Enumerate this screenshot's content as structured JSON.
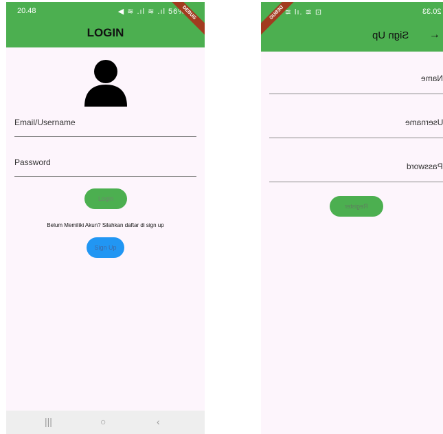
{
  "login_screen": {
    "status_bar": {
      "time": "20.48",
      "icons": "◀ ≋ .ıl ≋ .ıl 56%"
    },
    "debug_badge": "DEBUG",
    "title": "LOGIN",
    "avatar_icon": "person-icon",
    "email_label": "Email/Username",
    "password_label": "Password",
    "login_button": "Login",
    "signup_hint": "Belum Memiliki Akun? Silahkan daftar di sign up",
    "signup_button": "Sign Up",
    "nav": {
      "recents": "|||",
      "home": "○",
      "back": "‹"
    }
  },
  "signup_screen": {
    "status_bar": {
      "time": "20.33",
      "icons": "⊡ ≋ .ıl ≋ ⌀"
    },
    "debug_badge": "DEBUG",
    "title": "Sign Up",
    "back_icon": "←",
    "name_label": "Name",
    "username_label": "Username",
    "password_label": "Password",
    "register_button": "Register"
  },
  "colors": {
    "appbar": "#4caf50",
    "signup_button": "#2196f3",
    "background": "#fdf5fc"
  }
}
